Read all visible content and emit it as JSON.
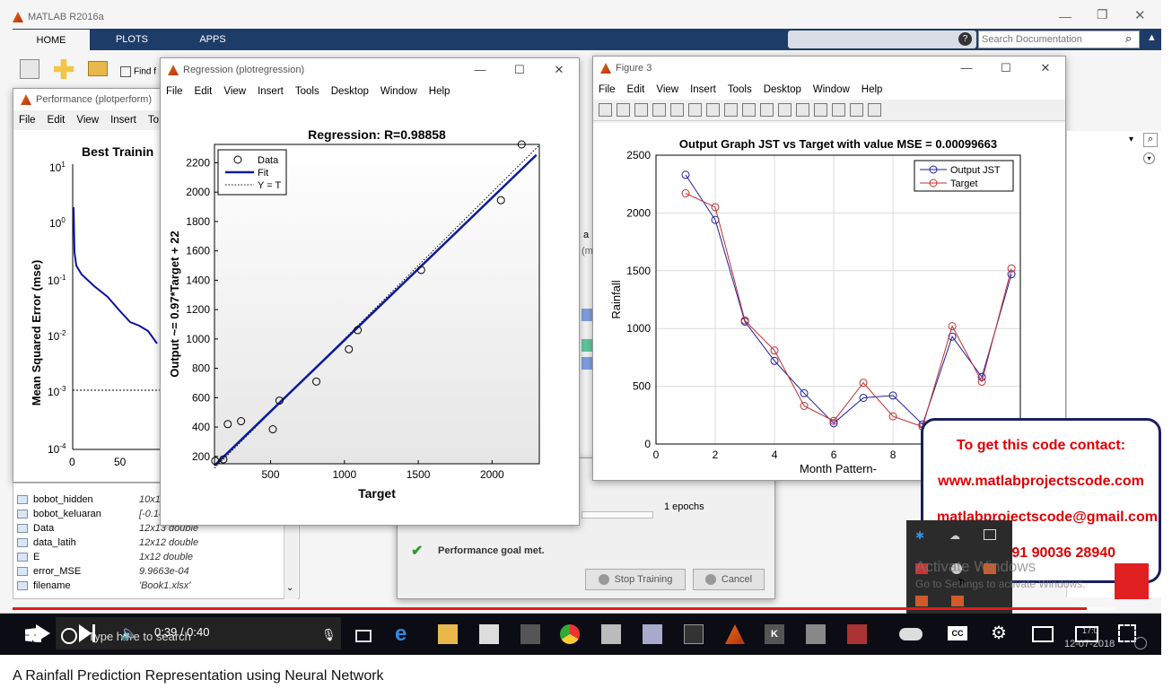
{
  "main_window": {
    "title": "MATLAB R2016a",
    "tabs": [
      "HOME",
      "PLOTS",
      "APPS"
    ],
    "search_placeholder": "Search Documentation",
    "find_label": "Find f"
  },
  "perf_window": {
    "title": "Performance (plotperform)",
    "menu": [
      "File",
      "Edit",
      "View",
      "Insert",
      "To"
    ],
    "plot_title": "Best Trainin",
    "ylabel": "Mean Squared Error  (mse)",
    "xticks": [
      "0",
      "50"
    ]
  },
  "workspace": {
    "rows": [
      {
        "name": "bobot_hidden",
        "value": "10x12 d"
      },
      {
        "name": "bobot_keluaran",
        "value": "[-0.144"
      },
      {
        "name": "Data",
        "value": "12x13 double"
      },
      {
        "name": "data_latih",
        "value": "12x12 double"
      },
      {
        "name": "E",
        "value": "1x12 double"
      },
      {
        "name": "error_MSE",
        "value": "9.9663e-04"
      },
      {
        "name": "filename",
        "value": "'Book1.xlsx'"
      }
    ]
  },
  "training_window": {
    "epochs": "1 epochs",
    "goal_met": "Performance goal met.",
    "stop_button": "Stop Training",
    "cancel_button": "Cancel",
    "fragment_m": "a M",
    "fragment_m2": "(m"
  },
  "regression_window": {
    "title": "Regression (plotregression)",
    "menu": [
      "File",
      "Edit",
      "View",
      "Insert",
      "Tools",
      "Desktop",
      "Window",
      "Help"
    ],
    "plot_title": "Regression: R=0.98858",
    "xlabel": "Target",
    "ylabel": "Output ~= 0.97*Target + 22",
    "legend": [
      "Data",
      "Fit",
      "Y = T"
    ],
    "yticks": [
      "200",
      "400",
      "600",
      "800",
      "1000",
      "1200",
      "1400",
      "1600",
      "1800",
      "2000",
      "2200"
    ],
    "xticks": [
      "500",
      "1000",
      "1500",
      "2000"
    ],
    "points": [
      [
        125,
        170
      ],
      [
        180,
        180
      ],
      [
        210,
        420
      ],
      [
        300,
        440
      ],
      [
        515,
        385
      ],
      [
        560,
        580
      ],
      [
        810,
        710
      ],
      [
        1030,
        930
      ],
      [
        1090,
        1060
      ],
      [
        1520,
        1470
      ],
      [
        2060,
        1945
      ],
      [
        2200,
        2325
      ]
    ],
    "fit": [
      [
        120,
        138
      ],
      [
        2300,
        2253
      ]
    ],
    "xlim": [
      120,
      2320
    ],
    "ylim": [
      150,
      2325
    ]
  },
  "figure3_window": {
    "title": "Figure 3",
    "menu": [
      "File",
      "Edit",
      "View",
      "Insert",
      "Tools",
      "Desktop",
      "Window",
      "Help"
    ]
  },
  "chart_data": {
    "type": "line",
    "title": "Output Graph JST vs Target with value MSE = 0.00099663",
    "xlabel": "Month Pattern-",
    "ylabel": "Rainfall",
    "x": [
      1,
      2,
      3,
      4,
      5,
      6,
      7,
      8,
      9,
      10,
      11,
      12
    ],
    "xlim": [
      0,
      12.3
    ],
    "ylim": [
      0,
      2500
    ],
    "xticks": [
      "0",
      "2",
      "4",
      "6",
      "8"
    ],
    "yticks": [
      "0",
      "500",
      "1000",
      "1500",
      "2000",
      "2500"
    ],
    "grid": true,
    "legend_position": "top-right",
    "series": [
      {
        "name": "Output JST",
        "color": "#1f1f9e",
        "values": [
          2330,
          1940,
          1060,
          720,
          440,
          180,
          400,
          420,
          170,
          930,
          580,
          1470
        ]
      },
      {
        "name": "Target",
        "color": "#c03030",
        "values": [
          2170,
          2050,
          1070,
          810,
          330,
          200,
          530,
          240,
          150,
          1020,
          540,
          1520
        ]
      }
    ]
  },
  "promo": {
    "line1": "To get this code contact:",
    "line2": "www.matlabprojectscode.com",
    "line3": "matlabprojectscode@gmail.com",
    "line4": "+91 90036 28940"
  },
  "activate": {
    "line1": "Activate Windows",
    "line2": "Go to Settings to activate Windows."
  },
  "taskbar": {
    "search": "Type here to search",
    "date": "12-07-2018",
    "time": "17:0"
  },
  "player": {
    "time": "0:39 / 0:40",
    "progress": 0.975
  },
  "video_title": "A Rainfall Prediction Representation using Neural Network"
}
